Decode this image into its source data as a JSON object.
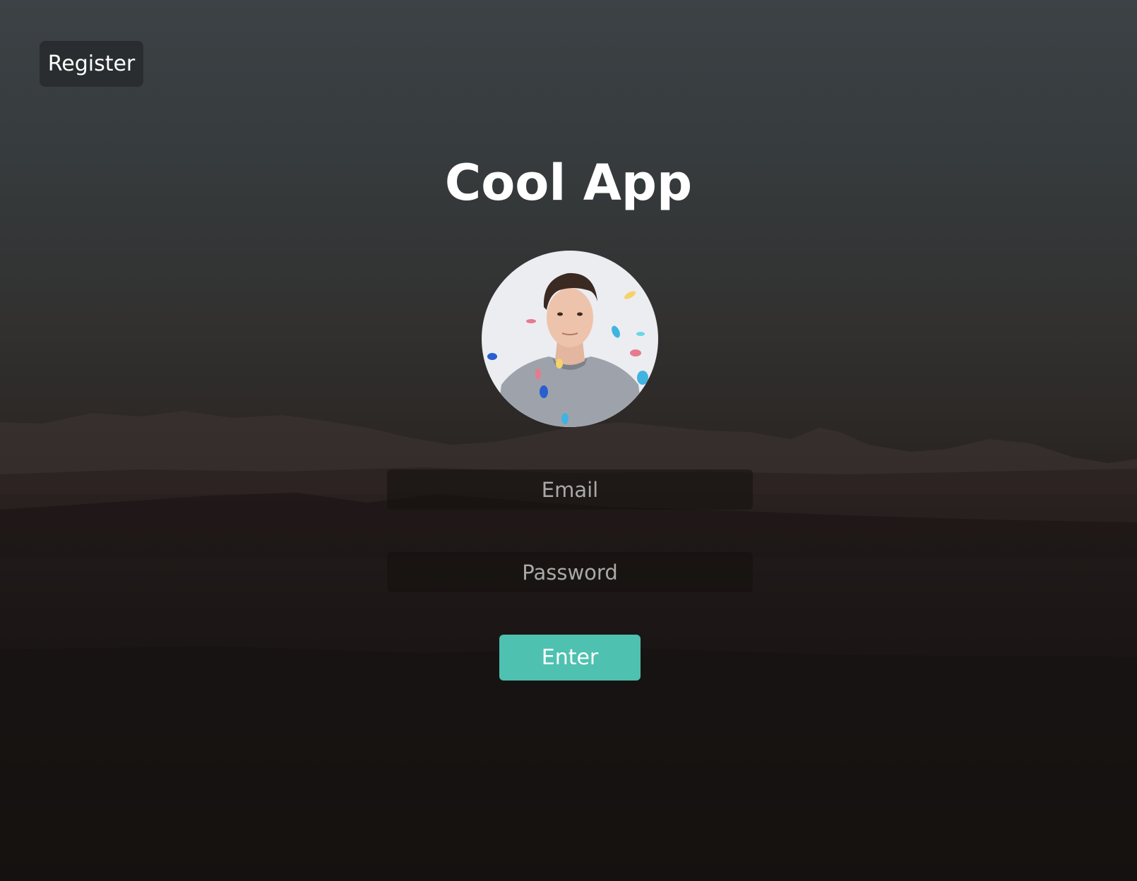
{
  "header": {
    "register_label": "Register"
  },
  "main": {
    "title": "Cool App",
    "email_placeholder": "Email",
    "password_placeholder": "Password",
    "enter_label": "Enter"
  },
  "colors": {
    "accent": "#4ec1b0",
    "register_bg": "#2a2d2f"
  },
  "icons": {
    "avatar": "user-avatar-photo"
  }
}
